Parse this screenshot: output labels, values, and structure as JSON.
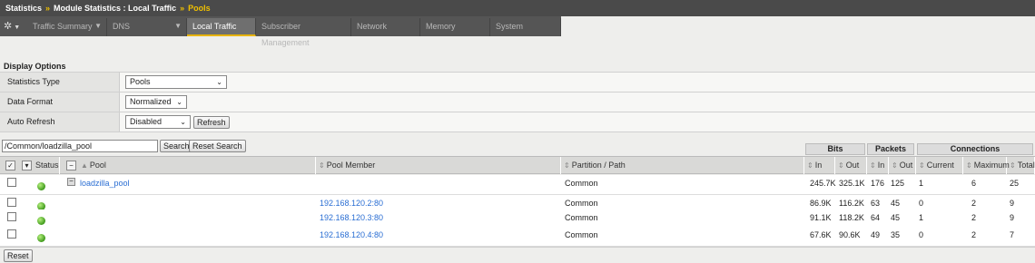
{
  "breadcrumb": {
    "part1": "Statistics",
    "sep": "»",
    "part2": "Module Statistics : Local Traffic",
    "current": "Pools"
  },
  "tabs": [
    {
      "label": "Traffic Summary",
      "has_menu": true
    },
    {
      "label": "DNS",
      "has_menu": true
    },
    {
      "label": "Local Traffic",
      "active": true
    },
    {
      "label": "Subscriber Management"
    },
    {
      "label": "Network"
    },
    {
      "label": "Memory"
    },
    {
      "label": "System"
    }
  ],
  "display_options": {
    "title": "Display Options",
    "stats_type_label": "Statistics Type",
    "stats_type_value": "Pools",
    "data_format_label": "Data Format",
    "data_format_value": "Normalized",
    "auto_refresh_label": "Auto Refresh",
    "auto_refresh_value": "Disabled",
    "refresh_button": "Refresh"
  },
  "search": {
    "value": "/Common/loadzilla_pool",
    "search_button": "Search",
    "reset_button": "Reset Search"
  },
  "groups": {
    "bits": "Bits",
    "packets": "Packets",
    "connections": "Connections"
  },
  "columns": {
    "status": "Status",
    "pool": "Pool",
    "pool_member": "Pool Member",
    "partition": "Partition / Path",
    "bits_in": "In",
    "bits_out": "Out",
    "pkts_in": "In",
    "pkts_out": "Out",
    "current": "Current",
    "maximum": "Maximum",
    "total": "Total"
  },
  "rows": [
    {
      "pool": "loadzilla_pool",
      "member": "",
      "partition": "Common",
      "bits_in": "245.7K",
      "bits_out": "325.1K",
      "pkts_in": "176",
      "pkts_out": "125",
      "current": "1",
      "maximum": "6",
      "total": "25"
    },
    {
      "pool": "",
      "member": "192.168.120.2:80",
      "partition": "Common",
      "bits_in": "86.9K",
      "bits_out": "116.2K",
      "pkts_in": "63",
      "pkts_out": "45",
      "current": "0",
      "maximum": "2",
      "total": "9"
    },
    {
      "pool": "",
      "member": "192.168.120.3:80",
      "partition": "Common",
      "bits_in": "91.1K",
      "bits_out": "118.2K",
      "pkts_in": "64",
      "pkts_out": "45",
      "current": "1",
      "maximum": "2",
      "total": "9"
    },
    {
      "pool": "",
      "member": "192.168.120.4:80",
      "partition": "Common",
      "bits_in": "67.6K",
      "bits_out": "90.6K",
      "pkts_in": "49",
      "pkts_out": "35",
      "current": "0",
      "maximum": "2",
      "total": "7"
    }
  ],
  "footer": {
    "reset_button": "Reset"
  },
  "colors": {
    "accent": "#f0c000",
    "link": "#2a6ed3",
    "status_green": "#3f9a1c"
  }
}
